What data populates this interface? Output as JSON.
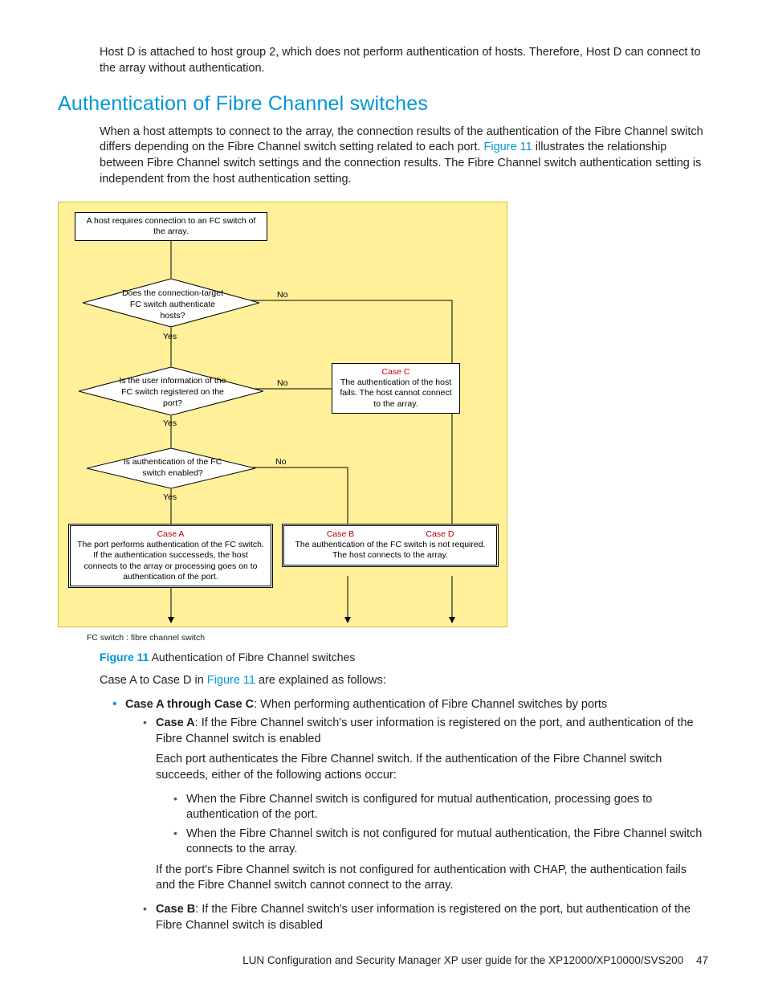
{
  "intro_para": "Host D is attached to host group 2, which does not perform authentication of hosts. Therefore, Host D can connect to the array without authentication.",
  "heading": "Authentication of Fibre Channel switches",
  "lead_para_a": "When a host attempts to connect to the array, the connection results of the authentication of the Fibre Channel switch differs depending on the Fibre Channel switch setting related to each port. ",
  "lead_figref": "Figure 11",
  "lead_para_b": " illustrates the relationship between Fibre Channel switch settings and the connection results. The Fibre Channel switch authentication setting is independent from the host authentication setting.",
  "diagram": {
    "start": "A host requires connection to an FC switch of the array.",
    "q1": "Does the connection-target FC switch authenticate hosts?",
    "q2": "Is the user information of the FC switch registered on the port?",
    "q3": "Is authentication of the FC switch enabled?",
    "yes": "Yes",
    "no": "No",
    "caseA_title": "Case A",
    "caseA_text": "The port performs authentication of the FC switch. If the authentication successeds, the host connects to the array or processing goes on to authentication of the port.",
    "caseB_title": "Case B",
    "caseD_title": "Case D",
    "caseBD_text": "The authentication of the FC switch is not required. The host connects to the array.",
    "caseC_title": "Case C",
    "caseC_text": "The authentication of the host fails. The host cannot connect to the array.",
    "legend": "FC switch : fibre channel switch"
  },
  "figcap_num": "Figure 11",
  "figcap_text": " Authentication of Fibre Channel switches",
  "after_fig_a": "Case A to Case D in ",
  "after_fig_ref": "Figure 11",
  "after_fig_b": " are explained as follows:",
  "bullets": {
    "abc_intro": "Case A through Case C",
    "abc_intro_rest": ": When performing authentication of Fibre Channel switches by ports",
    "caseA_b": "Case A",
    "caseA_rest": ": If the Fibre Channel switch's user information is registered on the port, and authentication of the Fibre Channel switch is enabled",
    "caseA_p1": "Each port authenticates the Fibre Channel switch. If the authentication of the Fibre Channel switch succeeds, either of the following actions occur:",
    "caseA_s1": "When the Fibre Channel switch is configured for mutual authentication, processing goes to authentication of the port.",
    "caseA_s2": "When the Fibre Channel switch is not configured for mutual authentication, the Fibre Channel switch connects to the array.",
    "caseA_p2": "If the port's Fibre Channel switch is not configured for authentication with CHAP, the authentication fails and the Fibre Channel switch cannot connect to the array.",
    "caseB_b": "Case B",
    "caseB_rest": ": If the Fibre Channel switch's user information is registered on the port, but authentication of the Fibre Channel switch is disabled"
  },
  "footer_text": "LUN Configuration and Security Manager XP user guide for the XP12000/XP10000/SVS200",
  "page_num": "47"
}
